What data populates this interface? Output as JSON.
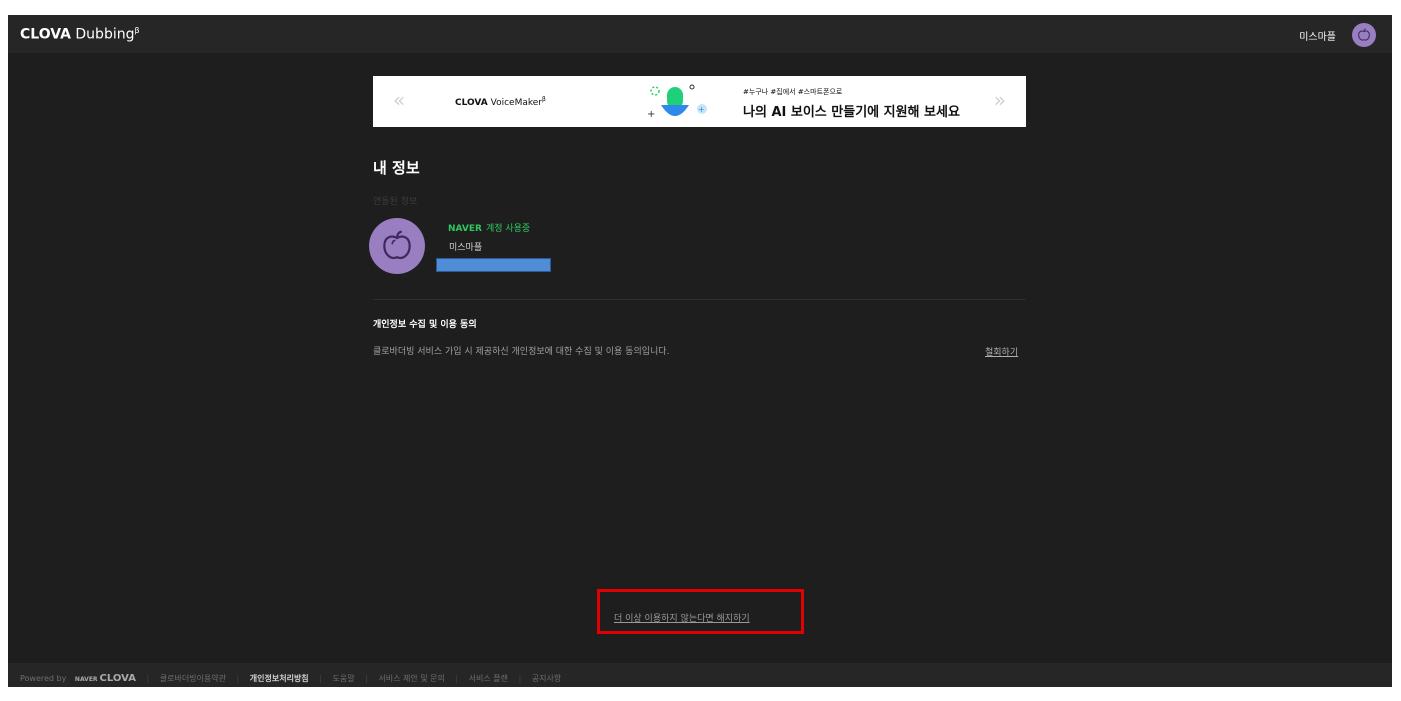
{
  "header": {
    "logo_main": "CLOVA",
    "logo_sub": "Dubbing",
    "logo_mark": "β",
    "user_name": "미스마플",
    "avatar_icon": "apple-icon"
  },
  "banner": {
    "prev_label": "«",
    "next_label": "»",
    "brand_main": "CLOVA",
    "brand_sub": "VoiceMaker",
    "brand_mark": "β",
    "tags": "#누구나 #집에서 #스마트폰으로",
    "headline": "나의 AI 보이스 만들기에 지원해 보세요"
  },
  "profile": {
    "title": "내 정보",
    "linked_label": "연동된 정보",
    "naver_brand": "NAVER",
    "naver_status": "계정 사용중",
    "name": "미스마플"
  },
  "consent": {
    "title": "개인정보 수집 및 이용 동의",
    "description": "클로바더빙 서비스 가입 시 제공하신 개인정보에 대한 수집 및 이용 동의입니다.",
    "withdraw_label": "철회하기"
  },
  "cancel_link": "더 이상 이용하지 않는다면 해지하기",
  "footer": {
    "powered_by": "Powered by",
    "naver_word": "NAVER",
    "clova_word": "CLOVA",
    "terms": "클로바더빙이용약관",
    "privacy": "개인정보처리방침",
    "help": "도움말",
    "inquiry": "서비스 제안 및 문의",
    "plans": "서비스 플랜",
    "notice": "공지사항"
  },
  "colors": {
    "background": "#1e1e1e",
    "naver_green": "#2fc85e",
    "avatar": "#9a7ec2",
    "highlight": "#e30000"
  }
}
